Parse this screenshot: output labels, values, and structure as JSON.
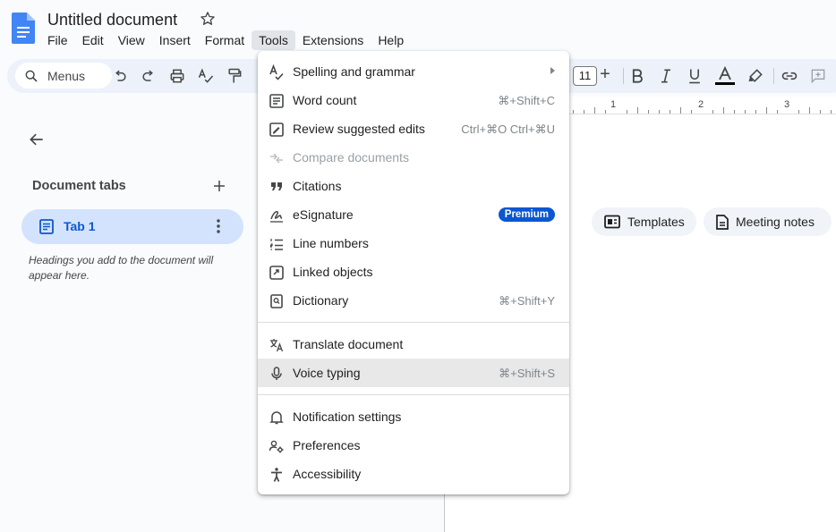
{
  "document": {
    "title": "Untitled document"
  },
  "menubar": [
    "File",
    "Edit",
    "View",
    "Insert",
    "Format",
    "Tools",
    "Extensions",
    "Help"
  ],
  "toolbar": {
    "search_placeholder": "Menus",
    "font_size": "11"
  },
  "ruler": {
    "numbers": [
      "1",
      "2",
      "3"
    ]
  },
  "left_panel": {
    "section_title": "Document tabs",
    "tab_label": "Tab 1",
    "hint": "Headings you add to the document will appear here."
  },
  "chips": {
    "templates": "Templates",
    "meeting_notes": "Meeting notes"
  },
  "tools_menu": {
    "items": [
      {
        "label": "Spelling and grammar",
        "icon": "spellcheck-icon",
        "submenu": true
      },
      {
        "label": "Word count",
        "icon": "word-count-icon",
        "shortcut": "⌘+Shift+C"
      },
      {
        "label": "Review suggested edits",
        "icon": "review-edits-icon",
        "shortcut": "Ctrl+⌘O Ctrl+⌘U"
      },
      {
        "label": "Compare documents",
        "icon": "compare-icon",
        "disabled": true
      },
      {
        "label": "Citations",
        "icon": "quote-icon"
      },
      {
        "label": "eSignature",
        "icon": "signature-icon",
        "badge": "Premium"
      },
      {
        "label": "Line numbers",
        "icon": "line-numbers-icon"
      },
      {
        "label": "Linked objects",
        "icon": "link-box-icon"
      },
      {
        "label": "Dictionary",
        "icon": "dictionary-icon",
        "shortcut": "⌘+Shift+Y"
      },
      {
        "label": "Translate document",
        "icon": "translate-icon"
      },
      {
        "label": "Voice typing",
        "icon": "microphone-icon",
        "shortcut": "⌘+Shift+S",
        "highlighted": true
      },
      {
        "label": "Notification settings",
        "icon": "bell-icon"
      },
      {
        "label": "Preferences",
        "icon": "preferences-icon"
      },
      {
        "label": "Accessibility",
        "icon": "accessibility-icon"
      }
    ]
  },
  "colors": {
    "accent": "#0b57d0",
    "tab_bg": "#d3e3fd",
    "toolbar_bg": "#edf2fa",
    "hover": "#e8e8e8"
  }
}
